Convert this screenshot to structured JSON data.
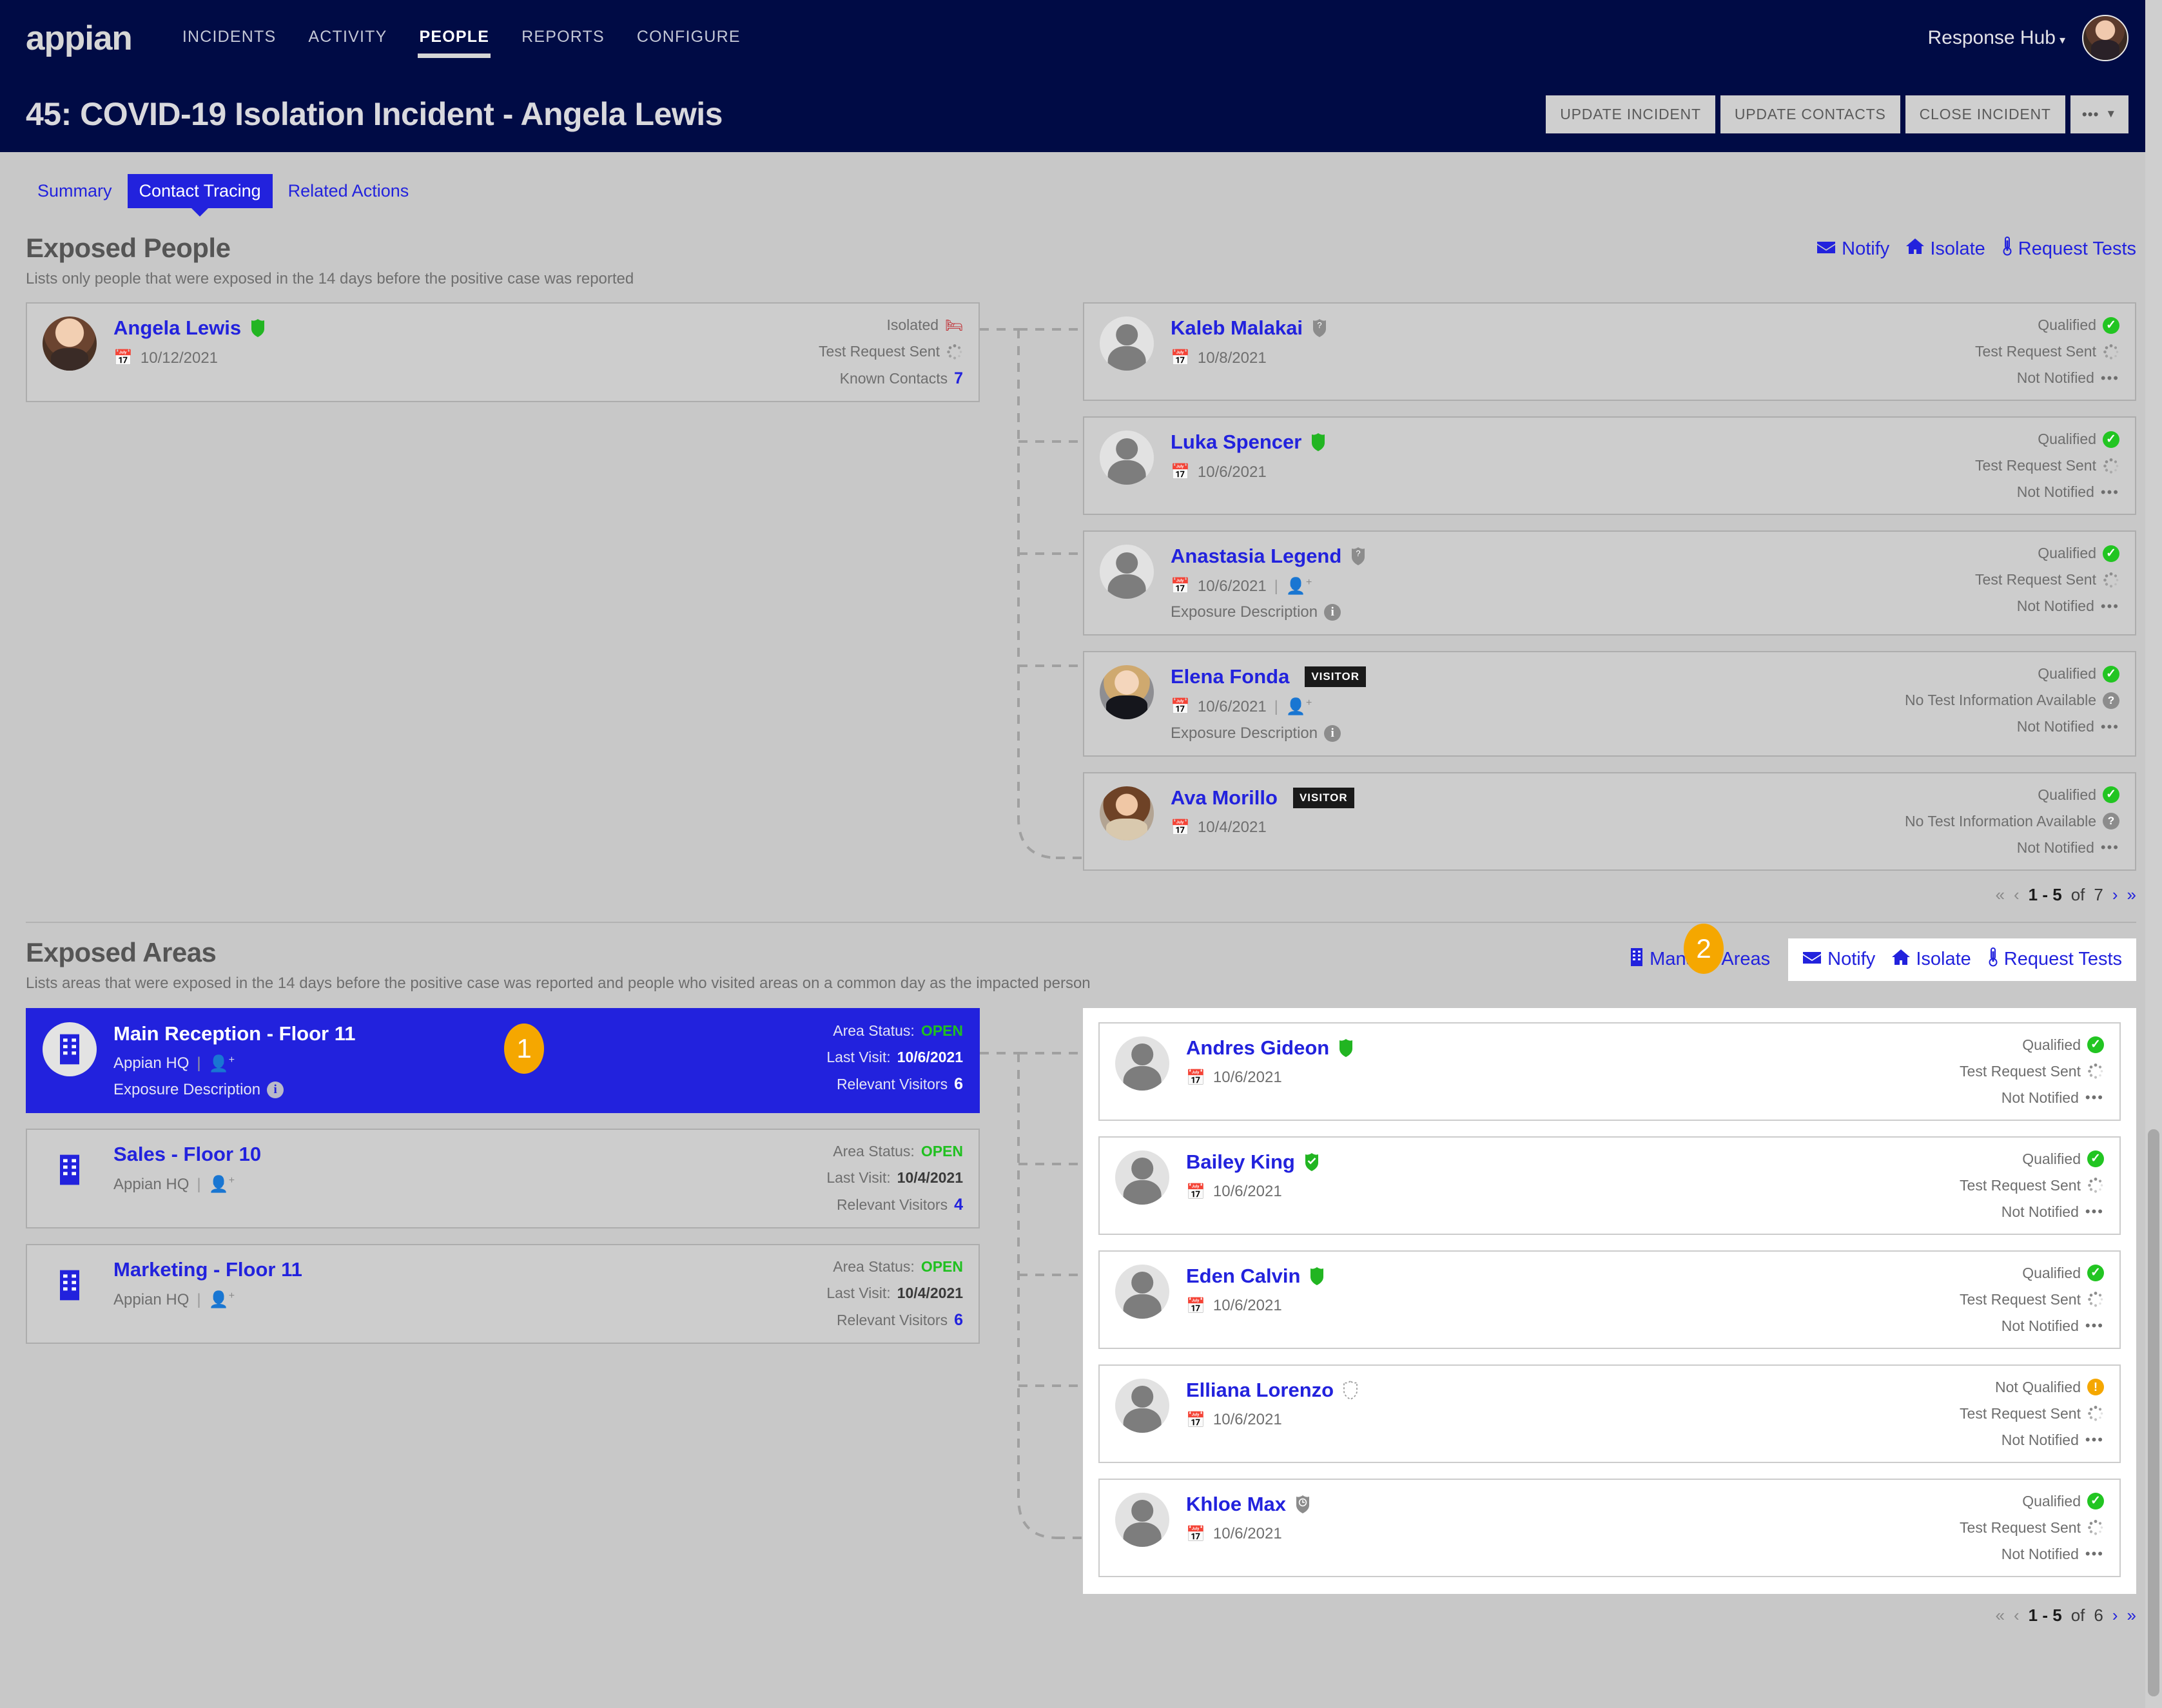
{
  "nav": {
    "logo": "appian",
    "items": [
      {
        "label": "INCIDENTS",
        "active": false
      },
      {
        "label": "ACTIVITY",
        "active": false
      },
      {
        "label": "PEOPLE",
        "active": true
      },
      {
        "label": "REPORTS",
        "active": false
      },
      {
        "label": "CONFIGURE",
        "active": false
      }
    ],
    "hub_label": "Response Hub",
    "hub_caret": "▾"
  },
  "header": {
    "title": "45: COVID-19 Isolation Incident - Angela Lewis",
    "buttons": [
      {
        "label": "UPDATE INCIDENT"
      },
      {
        "label": "UPDATE CONTACTS"
      },
      {
        "label": "CLOSE INCIDENT"
      }
    ],
    "more_label": "•••",
    "more_caret": "▼"
  },
  "tabs": [
    {
      "label": "Summary",
      "active": false
    },
    {
      "label": "Contact Tracing",
      "active": true
    },
    {
      "label": "Related Actions",
      "active": false
    }
  ],
  "exposed_people": {
    "title": "Exposed People",
    "subtitle": "Lists only people that were exposed in the 14 days before the positive case was reported",
    "actions": [
      {
        "label": "Notify",
        "icon": "envelope-icon"
      },
      {
        "label": "Isolate",
        "icon": "house-icon"
      },
      {
        "label": "Request Tests",
        "icon": "thermometer-icon"
      }
    ],
    "source_person": {
      "name": "Angela Lewis",
      "shield": "green",
      "date": "10/12/2021",
      "status_lines": [
        {
          "label": "Isolated",
          "icon": "bed-icon"
        },
        {
          "label": "Test Request Sent",
          "icon": "spinner-icon"
        },
        {
          "label": "Known Contacts",
          "value": "7",
          "icon": "none"
        }
      ]
    },
    "contacts": [
      {
        "name": "Kaleb Malakai",
        "shield": "gray-question",
        "date": "10/8/2021",
        "visitor": false,
        "has_add_user": false,
        "exposure_description": null,
        "status_lines": [
          {
            "label": "Qualified",
            "icon": "check-green"
          },
          {
            "label": "Test Request Sent",
            "icon": "spinner-icon"
          },
          {
            "label": "Not Notified",
            "icon": "ellipsis-icon"
          }
        ]
      },
      {
        "name": "Luka Spencer",
        "shield": "green",
        "date": "10/6/2021",
        "visitor": false,
        "has_add_user": false,
        "exposure_description": null,
        "status_lines": [
          {
            "label": "Qualified",
            "icon": "check-green"
          },
          {
            "label": "Test Request Sent",
            "icon": "spinner-icon"
          },
          {
            "label": "Not Notified",
            "icon": "ellipsis-icon"
          }
        ]
      },
      {
        "name": "Anastasia Legend",
        "shield": "gray-question",
        "date": "10/6/2021",
        "visitor": false,
        "has_add_user": true,
        "exposure_description": "Exposure Description",
        "status_lines": [
          {
            "label": "Qualified",
            "icon": "check-green"
          },
          {
            "label": "Test Request Sent",
            "icon": "spinner-icon"
          },
          {
            "label": "Not Notified",
            "icon": "ellipsis-icon"
          }
        ]
      },
      {
        "name": "Elena Fonda",
        "shield": "none",
        "date": "10/6/2021",
        "visitor": true,
        "visitor_label": "VISITOR",
        "has_add_user": true,
        "exposure_description": "Exposure Description",
        "status_lines": [
          {
            "label": "Qualified",
            "icon": "check-green"
          },
          {
            "label": "No Test Information Available",
            "icon": "question-gray"
          },
          {
            "label": "Not Notified",
            "icon": "ellipsis-icon"
          }
        ]
      },
      {
        "name": "Ava Morillo",
        "shield": "none",
        "date": "10/4/2021",
        "visitor": true,
        "visitor_label": "VISITOR",
        "has_add_user": false,
        "exposure_description": null,
        "status_lines": [
          {
            "label": "Qualified",
            "icon": "check-green"
          },
          {
            "label": "No Test Information Available",
            "icon": "question-gray"
          },
          {
            "label": "Not Notified",
            "icon": "ellipsis-icon"
          }
        ]
      }
    ],
    "pager": {
      "first": "«",
      "prev": "‹",
      "range": "1 - 5",
      "of": "of",
      "total": "7",
      "next": "›",
      "last": "»"
    }
  },
  "exposed_areas": {
    "title": "Exposed Areas",
    "subtitle": "Lists areas that were exposed in the 14 days before the positive case was reported and people who visited areas on a common day as the impacted person",
    "manage_label": "Manage Areas",
    "manage_icon": "building-icon",
    "actions": [
      {
        "label": "Notify",
        "icon": "envelope-icon"
      },
      {
        "label": "Isolate",
        "icon": "house-icon"
      },
      {
        "label": "Request Tests",
        "icon": "thermometer-icon"
      }
    ],
    "areas": [
      {
        "name": "Main Reception - Floor 11",
        "site": "Appian HQ",
        "selected": true,
        "exposure_description": "Exposure Description",
        "status": {
          "status_label": "Area Status:",
          "status_value": "OPEN",
          "visit_label": "Last Visit:",
          "visit_value": "10/6/2021",
          "visitors_label": "Relevant Visitors",
          "visitors_value": "6"
        }
      },
      {
        "name": "Sales - Floor 10",
        "site": "Appian HQ",
        "selected": false,
        "exposure_description": null,
        "status": {
          "status_label": "Area Status:",
          "status_value": "OPEN",
          "visit_label": "Last Visit:",
          "visit_value": "10/4/2021",
          "visitors_label": "Relevant Visitors",
          "visitors_value": "4"
        }
      },
      {
        "name": "Marketing - Floor 11",
        "site": "Appian HQ",
        "selected": false,
        "exposure_description": null,
        "status": {
          "status_label": "Area Status:",
          "status_value": "OPEN",
          "visit_label": "Last Visit:",
          "visit_value": "10/4/2021",
          "visitors_label": "Relevant Visitors",
          "visitors_value": "6"
        }
      }
    ],
    "visitors": [
      {
        "name": "Andres Gideon",
        "shield": "green",
        "date": "10/6/2021",
        "status_lines": [
          {
            "label": "Qualified",
            "icon": "check-green"
          },
          {
            "label": "Test Request Sent",
            "icon": "spinner-icon"
          },
          {
            "label": "Not Notified",
            "icon": "ellipsis-icon"
          }
        ]
      },
      {
        "name": "Bailey King",
        "shield": "green-check",
        "date": "10/6/2021",
        "status_lines": [
          {
            "label": "Qualified",
            "icon": "check-green"
          },
          {
            "label": "Test Request Sent",
            "icon": "spinner-icon"
          },
          {
            "label": "Not Notified",
            "icon": "ellipsis-icon"
          }
        ]
      },
      {
        "name": "Eden Calvin",
        "shield": "green",
        "date": "10/6/2021",
        "status_lines": [
          {
            "label": "Qualified",
            "icon": "check-green"
          },
          {
            "label": "Test Request Sent",
            "icon": "spinner-icon"
          },
          {
            "label": "Not Notified",
            "icon": "ellipsis-icon"
          }
        ]
      },
      {
        "name": "Elliana Lorenzo",
        "shield": "dashed",
        "date": "10/6/2021",
        "status_lines": [
          {
            "label": "Not Qualified",
            "icon": "alert-amber"
          },
          {
            "label": "Test Request Sent",
            "icon": "spinner-icon"
          },
          {
            "label": "Not Notified",
            "icon": "ellipsis-icon"
          }
        ]
      },
      {
        "name": "Khloe Max",
        "shield": "gray-clock",
        "date": "10/6/2021",
        "status_lines": [
          {
            "label": "Qualified",
            "icon": "check-green"
          },
          {
            "label": "Test Request Sent",
            "icon": "spinner-icon"
          },
          {
            "label": "Not Notified",
            "icon": "ellipsis-icon"
          }
        ]
      }
    ],
    "pager": {
      "first": "«",
      "prev": "‹",
      "range": "1 - 5",
      "of": "of",
      "total": "6",
      "next": "›",
      "last": "»"
    }
  },
  "markers": [
    {
      "label": "1"
    },
    {
      "label": "2"
    }
  ],
  "colors": {
    "brand_navy": "#000b45",
    "accent_blue": "#2222dd",
    "page_bg": "#c8c8c8",
    "ok_green": "#22c522",
    "warn_amber": "#f5a700",
    "danger_red": "#c0272d"
  }
}
